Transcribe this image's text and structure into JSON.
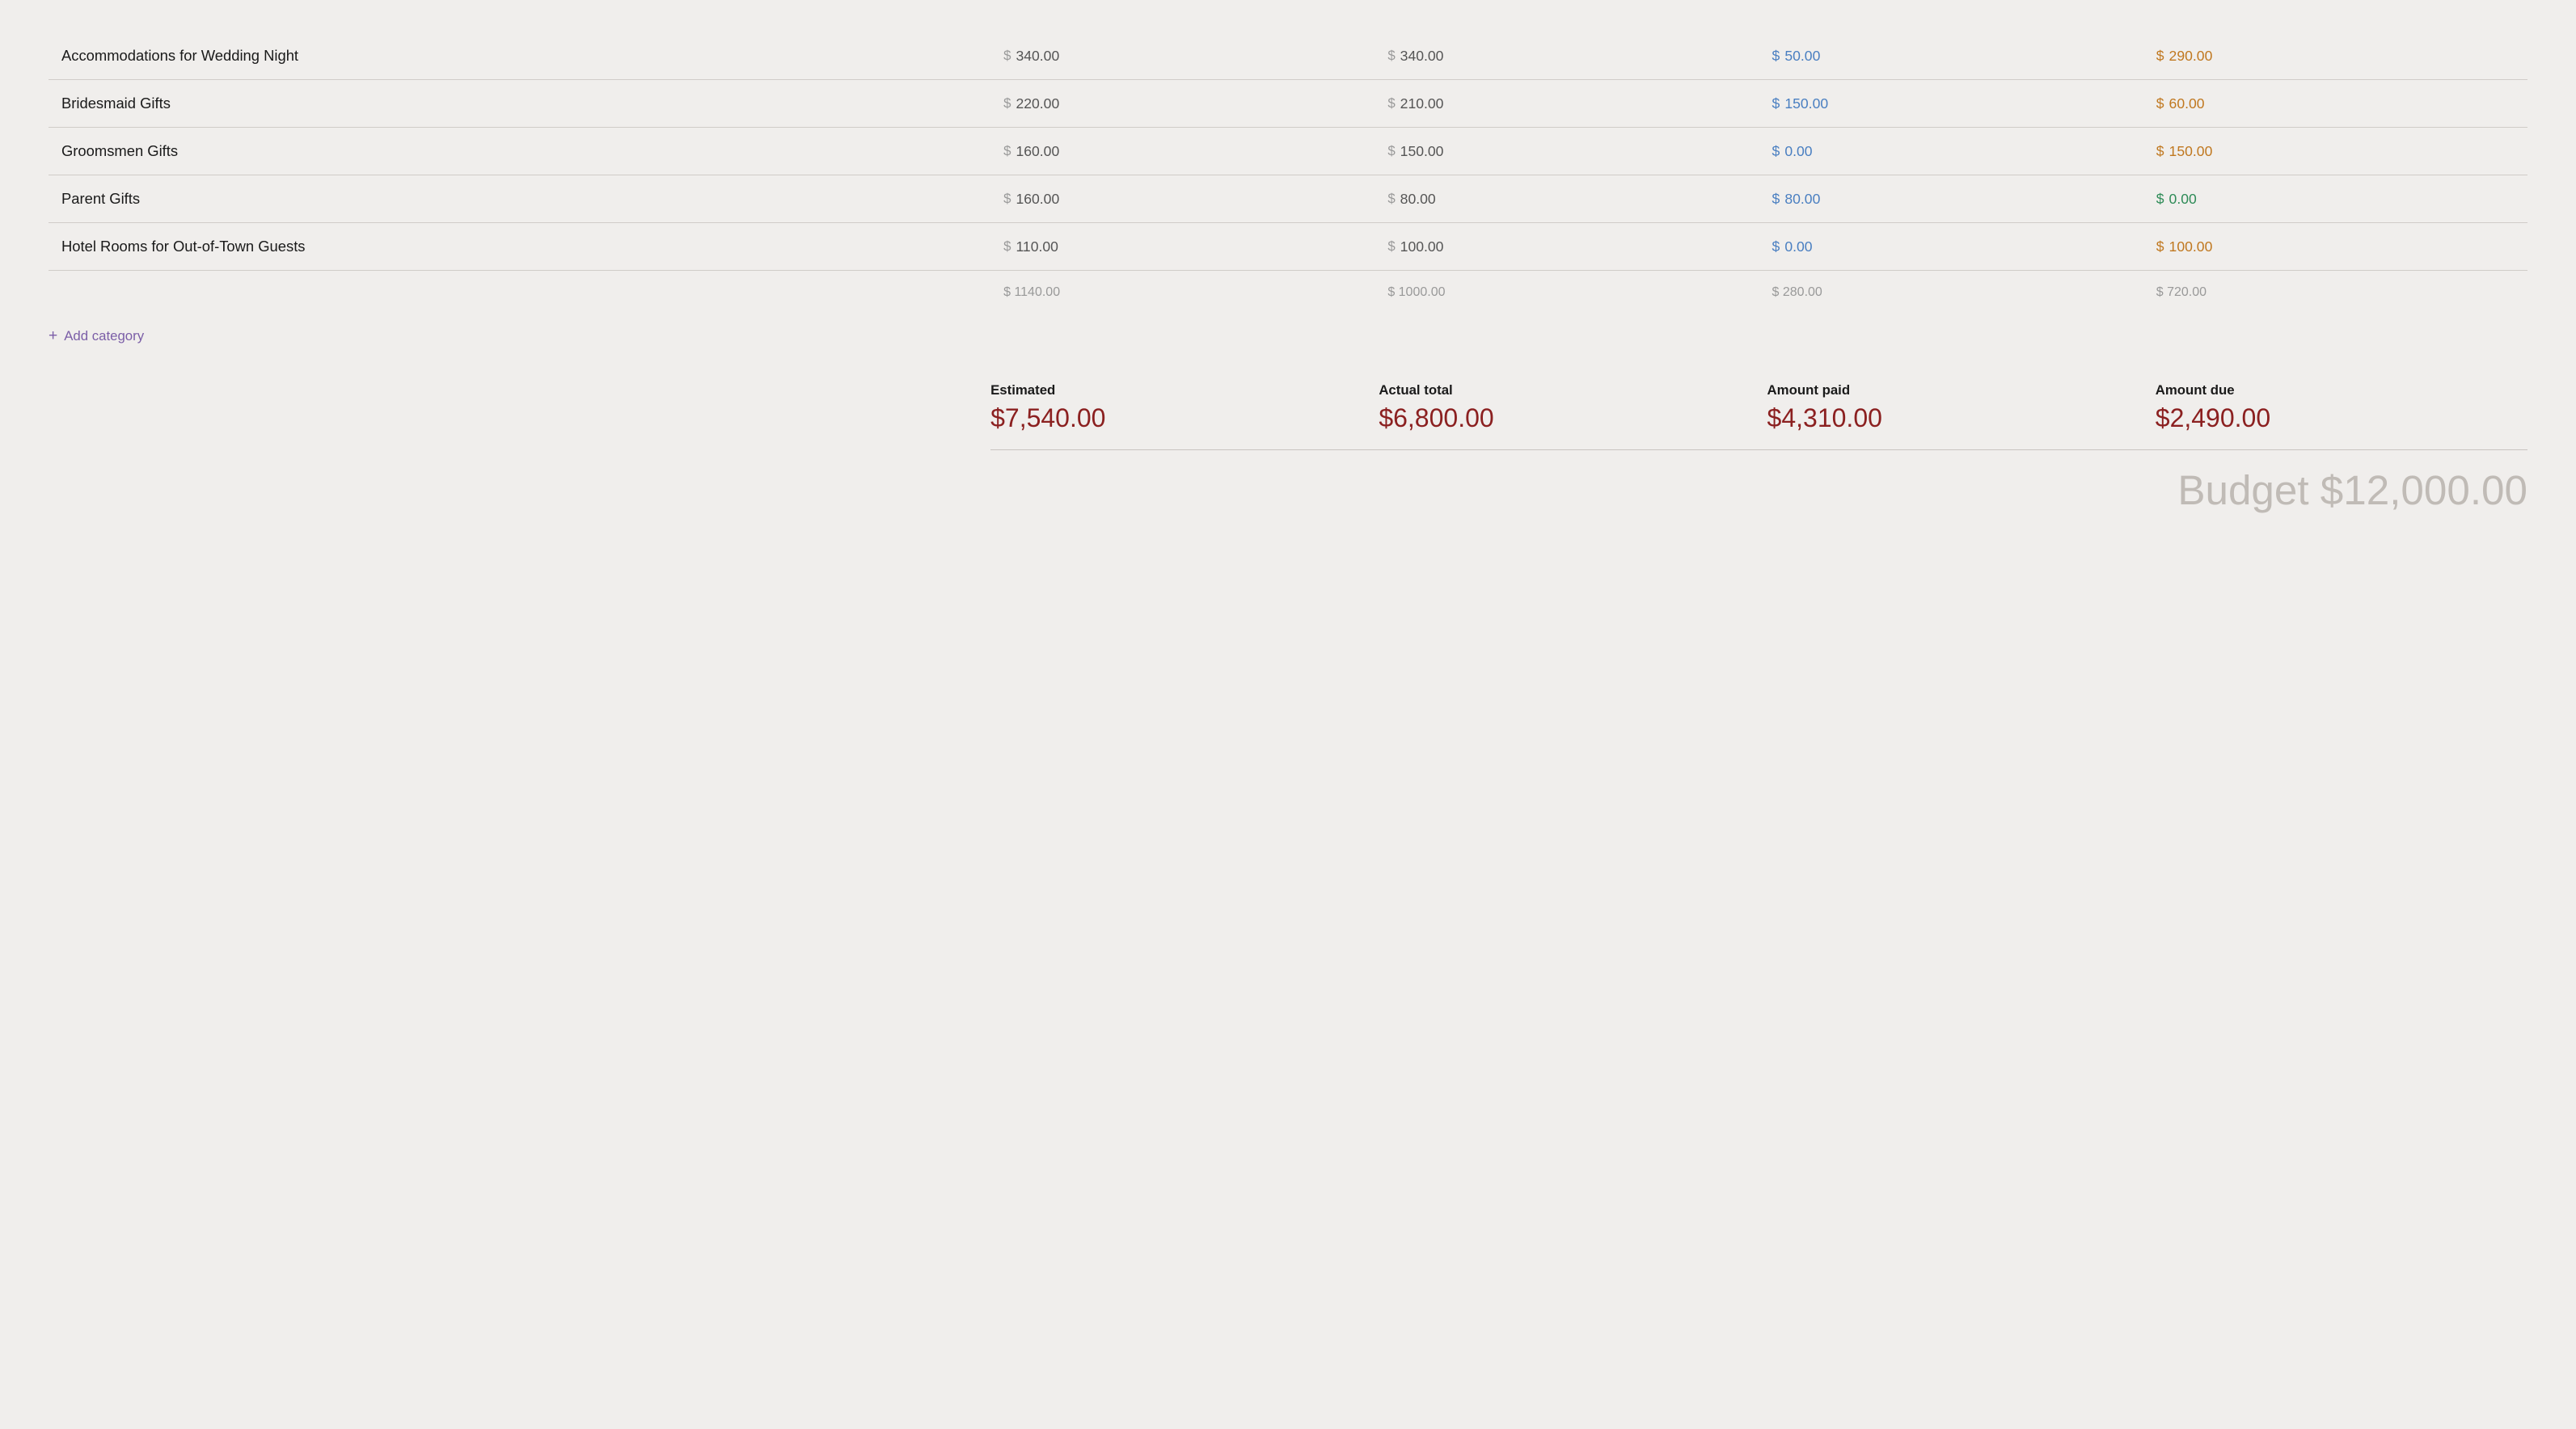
{
  "rows": [
    {
      "name": "Accommodations for Wedding Night",
      "estimated": "340.00",
      "actual": "340.00",
      "paid": "50.00",
      "due": "290.00",
      "paid_color": "blue",
      "due_color": "orange"
    },
    {
      "name": "Bridesmaid Gifts",
      "estimated": "220.00",
      "actual": "210.00",
      "paid": "150.00",
      "due": "60.00",
      "paid_color": "blue",
      "due_color": "orange"
    },
    {
      "name": "Groomsmen Gifts",
      "estimated": "160.00",
      "actual": "150.00",
      "paid": "0.00",
      "due": "150.00",
      "paid_color": "blue",
      "due_color": "orange"
    },
    {
      "name": "Parent Gifts",
      "estimated": "160.00",
      "actual": "80.00",
      "paid": "80.00",
      "due": "0.00",
      "paid_color": "blue",
      "due_color": "green"
    },
    {
      "name": "Hotel Rooms for Out-of-Town Guests",
      "estimated": "110.00",
      "actual": "100.00",
      "paid": "0.00",
      "due": "100.00",
      "paid_color": "blue",
      "due_color": "orange"
    }
  ],
  "row_totals": {
    "estimated": "$ 1140.00",
    "actual": "$ 1000.00",
    "paid": "$ 280.00",
    "due": "$ 720.00"
  },
  "add_category_label": "Add category",
  "summary": {
    "estimated_label": "Estimated",
    "estimated_value": "$7,540.00",
    "actual_label": "Actual total",
    "actual_value": "$6,800.00",
    "paid_label": "Amount paid",
    "paid_value": "$4,310.00",
    "due_label": "Amount due",
    "due_value": "$2,490.00"
  },
  "budget_label": "Budget $12,000.00",
  "dollar_sign": "$"
}
